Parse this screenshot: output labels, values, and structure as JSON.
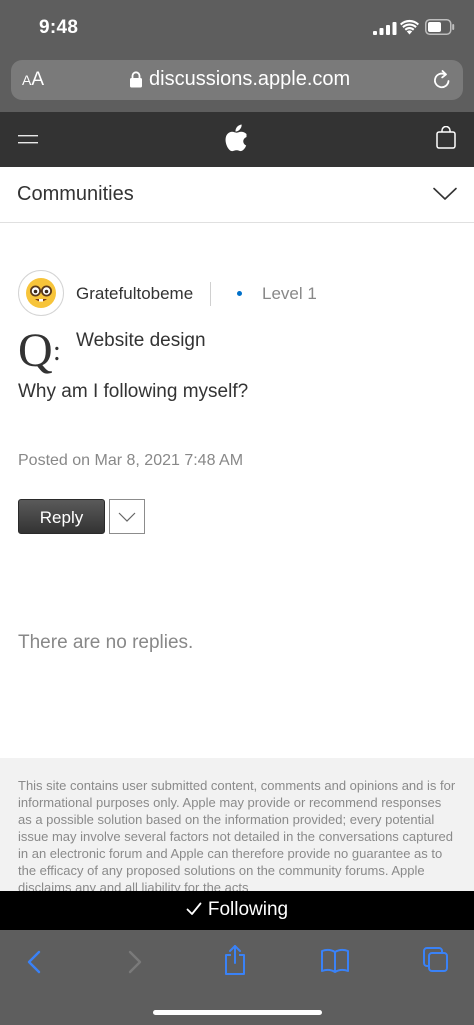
{
  "status_bar": {
    "time": "9:48"
  },
  "url_bar": {
    "text_size_label_large": "A",
    "text_size_label_small": "A",
    "url": "discussions.apple.com"
  },
  "communities": {
    "label": "Communities"
  },
  "post": {
    "username": "Gratefultobeme",
    "level": "Level 1",
    "q_letter": "Q",
    "title": "Website design",
    "body": "Why am I following myself?",
    "posted": "Posted on Mar 8, 2021 7:48 AM"
  },
  "reply": {
    "label": "Reply"
  },
  "replies": {
    "empty_text": "There are no replies."
  },
  "disclaimer": {
    "text": "This site contains user submitted content, comments and opinions and is for informational purposes only. Apple may provide or recommend responses as a possible solution based on the information provided; every potential issue may involve several factors not detailed in the conversations captured in an electronic forum and Apple can therefore provide no guarantee as to the efficacy of any proposed solutions on the community forums. Apple disclaims any and all liability for the acts"
  },
  "following": {
    "label": "Following"
  },
  "colors": {
    "chrome_gray": "#5e5e5e",
    "nav_dark": "#333333",
    "toolbar_blue": "#3a82f7",
    "level_dot": "#0070c9"
  },
  "icons": {
    "signal": "signal-icon",
    "wifi": "wifi-icon",
    "battery": "battery-icon",
    "lock": "lock-icon",
    "reload": "reload-icon",
    "menu": "menu-icon",
    "apple": "apple-logo-icon",
    "bag": "bag-icon",
    "chevron": "chevron-down-icon",
    "avatar": "nerd-face-emoji",
    "check": "check-icon",
    "back": "back-icon",
    "forward": "forward-icon",
    "share": "share-icon",
    "bookmarks": "bookmarks-icon",
    "tabs": "tabs-icon"
  }
}
